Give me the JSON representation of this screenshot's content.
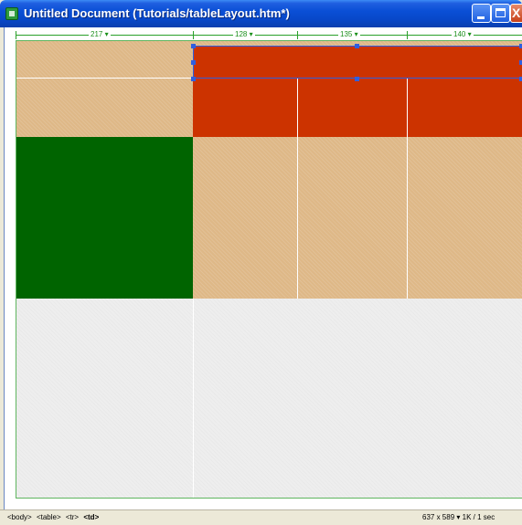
{
  "window": {
    "title": "Untitled Document (Tutorials/tableLayout.htm*)",
    "buttons": {
      "minimize": "",
      "maximize": "",
      "close": "X"
    }
  },
  "ruler": {
    "columns": [
      {
        "label": "217 ▾"
      },
      {
        "label": "128 ▾"
      },
      {
        "label": "135 ▾"
      },
      {
        "label": "140 ▾"
      }
    ]
  },
  "colors": {
    "tan": "#deb887",
    "red": "#cc3300",
    "green": "#006400",
    "light_grey": "#eeeeee",
    "selection": "#2f5fe0",
    "table_border": "#5fb55f"
  },
  "statusbar": {
    "tag_selector": [
      "<body>",
      "<table>",
      "<tr>",
      "<td>"
    ],
    "window_size": "637 x 589 ▾",
    "download": "1K / 1 sec"
  }
}
